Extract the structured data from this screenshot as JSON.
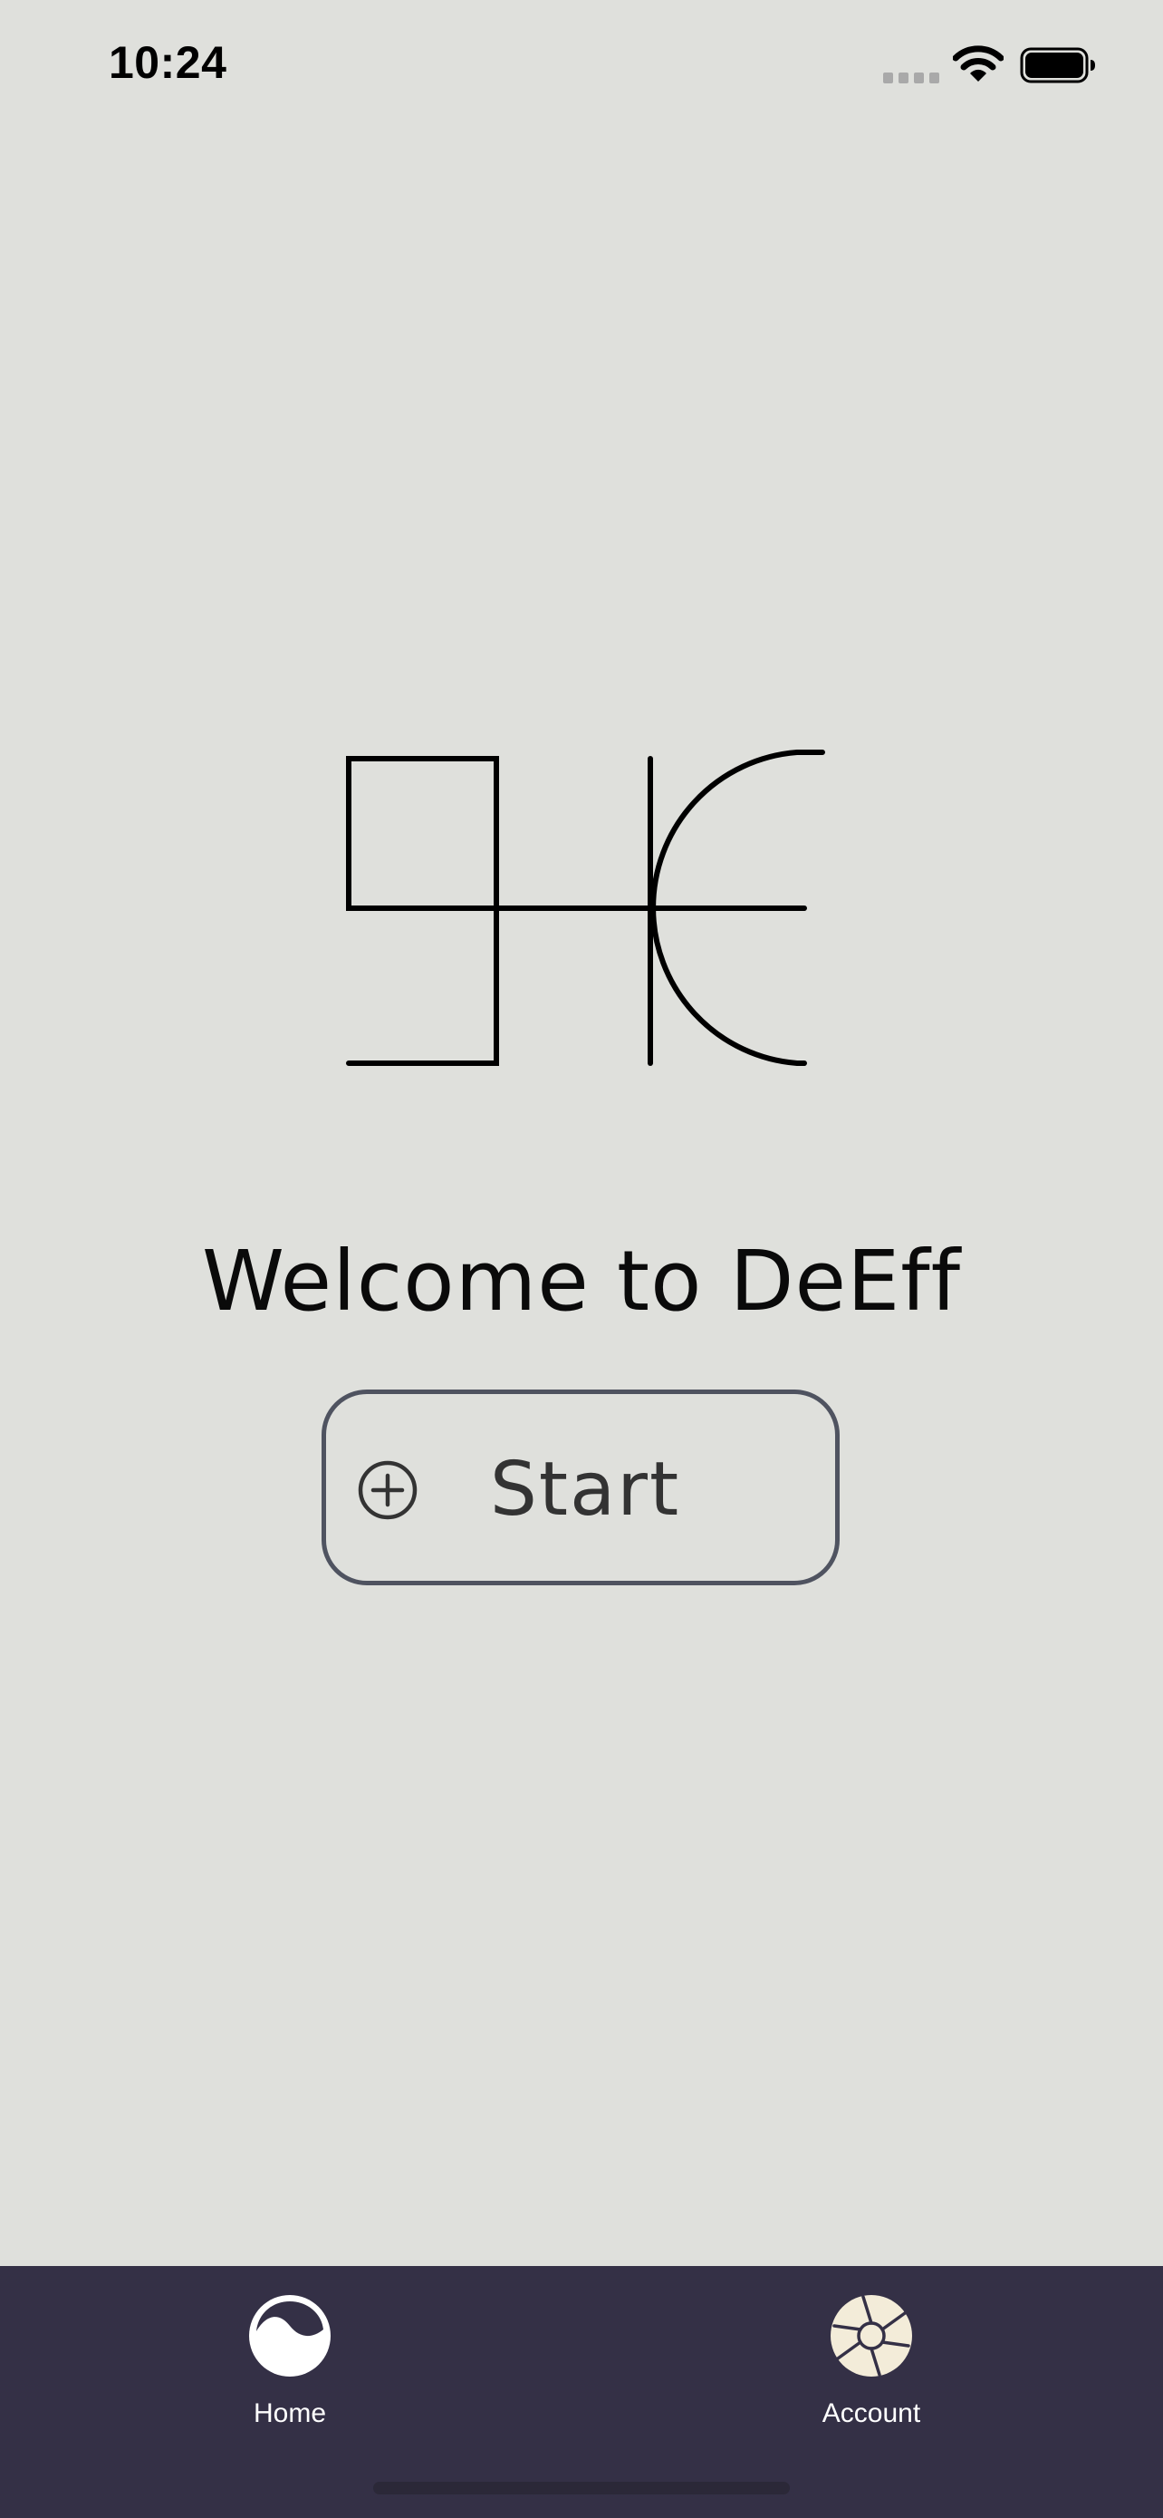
{
  "status_bar": {
    "time": "10:24"
  },
  "main": {
    "title": "Welcome to DeEff",
    "start_button": {
      "label": "Start",
      "icon": "plus-circle-icon"
    },
    "logo": {
      "icon": "deeff-logo"
    }
  },
  "tab_bar": {
    "tabs": [
      {
        "label": "Home",
        "icon": "wave-circle-icon"
      },
      {
        "label": "Account",
        "icon": "aperture-icon"
      }
    ]
  },
  "colors": {
    "background": "#dfe0dc",
    "tab_bar": "#343046",
    "button_border": "#4f5360",
    "text": "#0a0a0a",
    "account_icon": "#f3ecd9"
  }
}
